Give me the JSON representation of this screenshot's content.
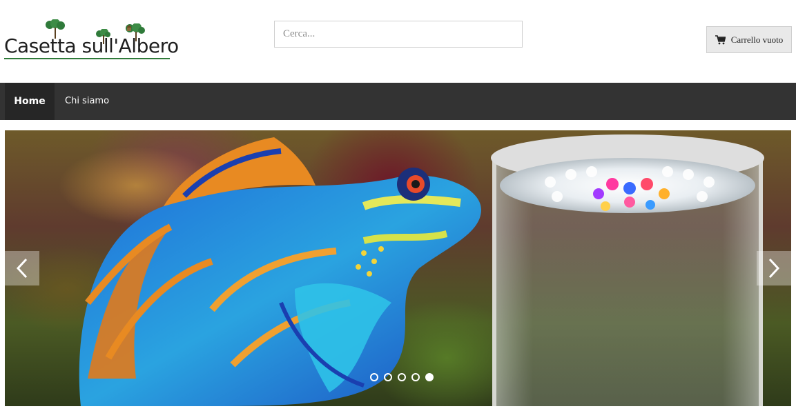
{
  "header": {
    "logo_text": "Casetta sull'Albero",
    "search": {
      "placeholder": "Cerca..."
    },
    "cart": {
      "label": "Carrello vuoto",
      "icon": "cart-icon"
    }
  },
  "nav": {
    "items": [
      {
        "label": "Home",
        "active": true
      },
      {
        "label": "Chi siamo",
        "active": false
      }
    ]
  },
  "slider": {
    "slide_count": 5,
    "active_index": 4,
    "prev_icon": "chevron-left-icon",
    "next_icon": "chevron-right-icon"
  },
  "colors": {
    "nav_bg": "#333333",
    "nav_active_bg": "#262626",
    "logo_green": "#2f7a3a"
  }
}
